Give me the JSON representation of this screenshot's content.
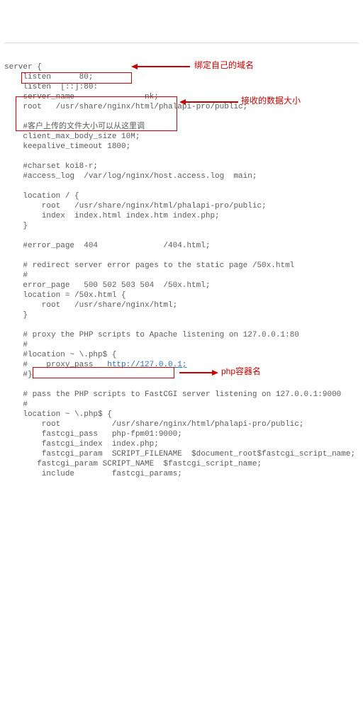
{
  "code": {
    "l01": "server {",
    "l02": "    listen      80;",
    "l03": "    listen  [::]:80:",
    "l04_a": "    server_name  ",
    "l04_b": "nk;",
    "l05": "    root   /usr/share/nginx/html/phalapi-pro/public;",
    "l06": "",
    "l07": "    #客户上传的文件大小可以从这里调",
    "l08": "    client_max_body_size 10M;",
    "l09": "    keepalive_timeout 1800;",
    "l10": "",
    "l11": "    #charset koi8-r;",
    "l12": "    #access_log  /var/log/nginx/host.access.log  main;",
    "l13": "",
    "l14": "    location / {",
    "l15": "        root   /usr/share/nginx/html/phalapi-pro/public;",
    "l16": "        index  index.html index.htm index.php;",
    "l17": "    }",
    "l18": "",
    "l19": "    #error_page  404              /404.html;",
    "l20": "",
    "l21": "    # redirect server error pages to the static page /50x.html",
    "l22": "    #",
    "l23": "    error_page   500 502 503 504  /50x.html;",
    "l24": "    location = /50x.html {",
    "l25": "        root   /usr/share/nginx/html;",
    "l26": "    }",
    "l27": "",
    "l28": "    # proxy the PHP scripts to Apache listening on 127.0.0.1:80",
    "l29": "    #",
    "l30": "    #location ~ \\.php$ {",
    "l31": "    #    proxy_pass   ",
    "l31_link": "http://127.0.0.1;",
    "l32": "    #}",
    "l33": "",
    "l34": "    # pass the PHP scripts to FastCGI server listening on 127.0.0.1:9000",
    "l35": "    #",
    "l36": "    location ~ \\.php$ {",
    "l37": "        root           /usr/share/nginx/html/phalapi-pro/public;",
    "l38": "        fastcgi_pass   php-fpm01:9000;",
    "l39": "        fastcgi_index  index.php;",
    "l40": "        fastcgi_param  SCRIPT_FILENAME  $document_root$fastcgi_script_name;",
    "l41": "       fastcgi_param SCRIPT_NAME  $fastcgi_script_name;",
    "l42": "        include        fastcgi_params;"
  },
  "annotations": {
    "domain_note": "绑定自己的域名",
    "body_size_note": "接收的数据大小",
    "php_container_note": "php容器名"
  },
  "colors": {
    "highlight": "#cc0000",
    "link": "#2b6fb5",
    "text": "#5b5b5b"
  }
}
